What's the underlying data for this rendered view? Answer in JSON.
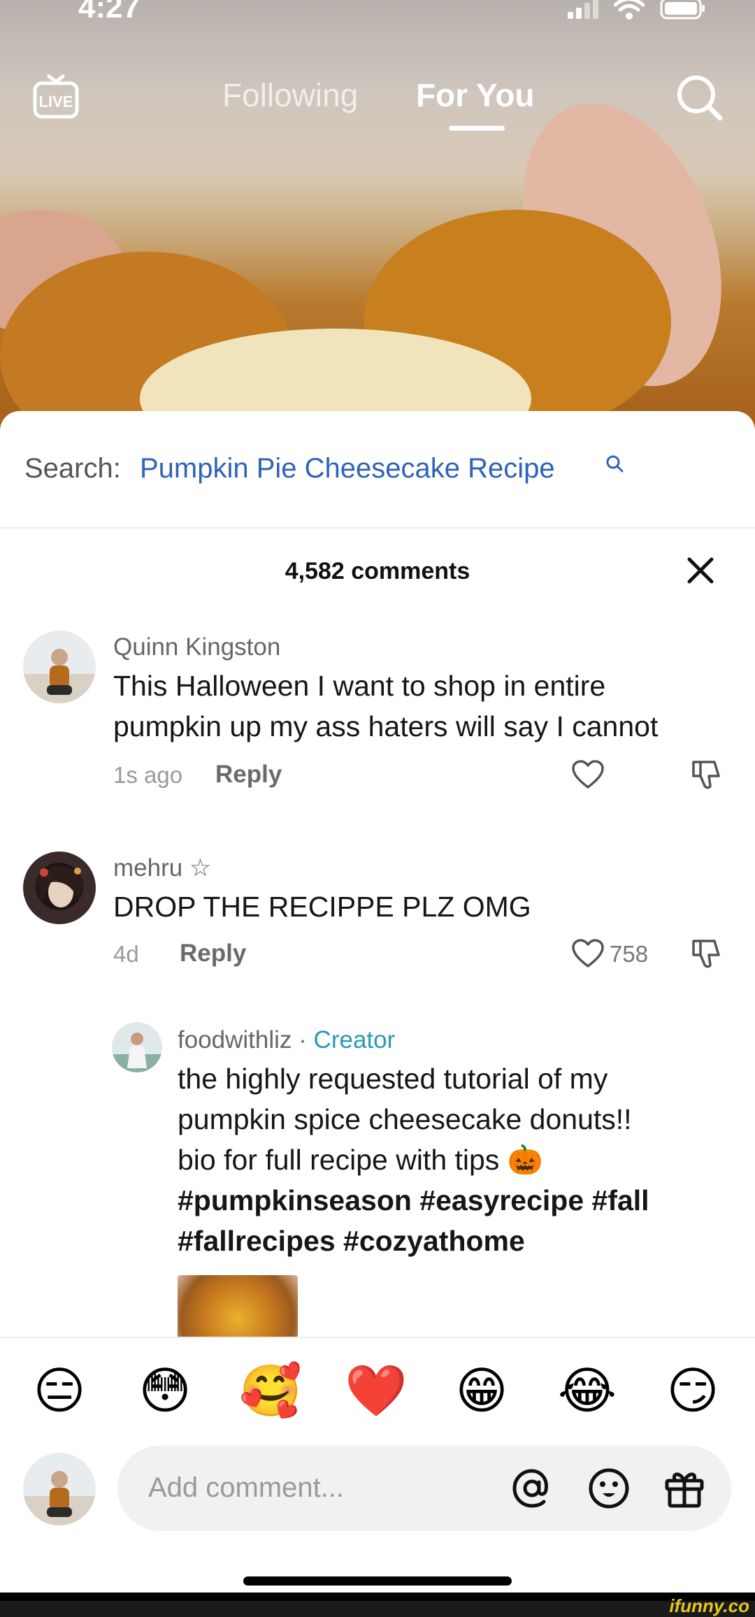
{
  "status_bar": {
    "time": "4:27"
  },
  "top_nav": {
    "live_label": "LIVE",
    "tabs": [
      {
        "label": "Following",
        "active": false
      },
      {
        "label": "For You",
        "active": true
      }
    ]
  },
  "search_suggestion": {
    "prefix": "Search:",
    "query": "Pumpkin Pie Cheesecake Recipe"
  },
  "comments_header": {
    "count_label": "4,582 comments"
  },
  "comments": [
    {
      "username": "Quinn Kingston",
      "text_line1": "This Halloween I want to shop in entire",
      "text_line2": "pumpkin up my ass haters will say I cannot",
      "time": "1s ago",
      "reply_label": "Reply",
      "likes": ""
    },
    {
      "username": "mehru ☆",
      "text_line1": "DROP THE RECIPPE PLZ OMG",
      "time": "4d",
      "reply_label": "Reply",
      "likes": "758"
    }
  ],
  "creator_reply": {
    "username": "foodwithliz",
    "separator": "·",
    "badge": "Creator",
    "lines": [
      "the highly requested tutorial of my",
      "pumpkin spice cheesecake donuts!!",
      "bio for full recipe with tips 🎃",
      "#pumpkinseason #easyrecipe #fall",
      "#fallrecipes #cozyathome"
    ]
  },
  "emoji_bar": [
    "😑",
    "😳",
    "🥰",
    "❤️",
    "😁",
    "😂",
    "😏"
  ],
  "composer": {
    "placeholder": "Add comment..."
  },
  "watermark": "ifunny.co",
  "colors": {
    "link_blue": "#2f63b8",
    "creator_teal": "#2a9ab5",
    "text": "#161616"
  },
  "icons": [
    "live-icon",
    "search-icon",
    "close-icon",
    "heart-icon",
    "dislike-icon",
    "at-icon",
    "smiley-icon",
    "gift-icon"
  ]
}
